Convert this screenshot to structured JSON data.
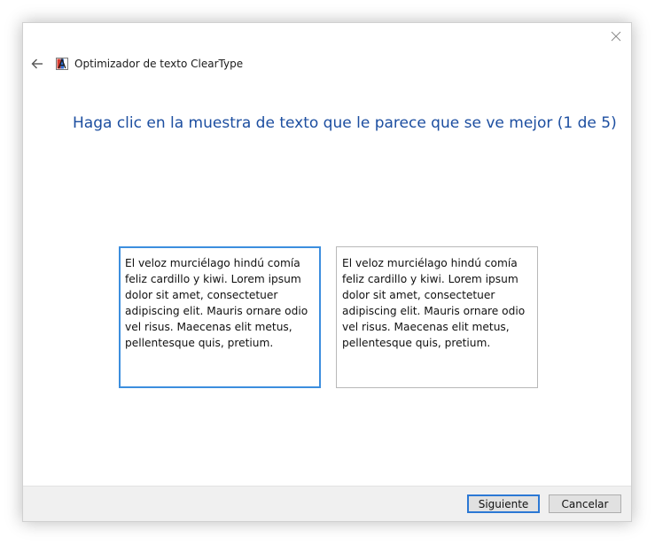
{
  "window": {
    "title": "Optimizador de texto ClearType"
  },
  "heading": "Haga clic en la muestra de texto que le parece que se ve mejor (1 de 5)",
  "samples": [
    {
      "text": "El veloz murciélago hindú comía feliz cardillo y kiwi. Lorem ipsum dolor sit amet, consectetuer adipiscing elit. Mauris ornare odio vel risus. Maecenas elit metus, pellentesque quis, pretium."
    },
    {
      "text": "El veloz murciélago hindú comía feliz cardillo y kiwi. Lorem ipsum dolor sit amet, consectetuer adipiscing elit. Mauris ornare odio vel risus. Maecenas elit metus, pellentesque quis, pretium."
    }
  ],
  "buttons": {
    "next_label": "Siguiente",
    "cancel_label": "Cancelar"
  },
  "colors": {
    "heading": "#1c4ea0",
    "selected_border": "#3c8ede",
    "footer_bg": "#f0f0f0"
  },
  "icons": {
    "close": "close-icon",
    "back": "back-arrow-icon",
    "app": "cleartype-app-icon"
  }
}
